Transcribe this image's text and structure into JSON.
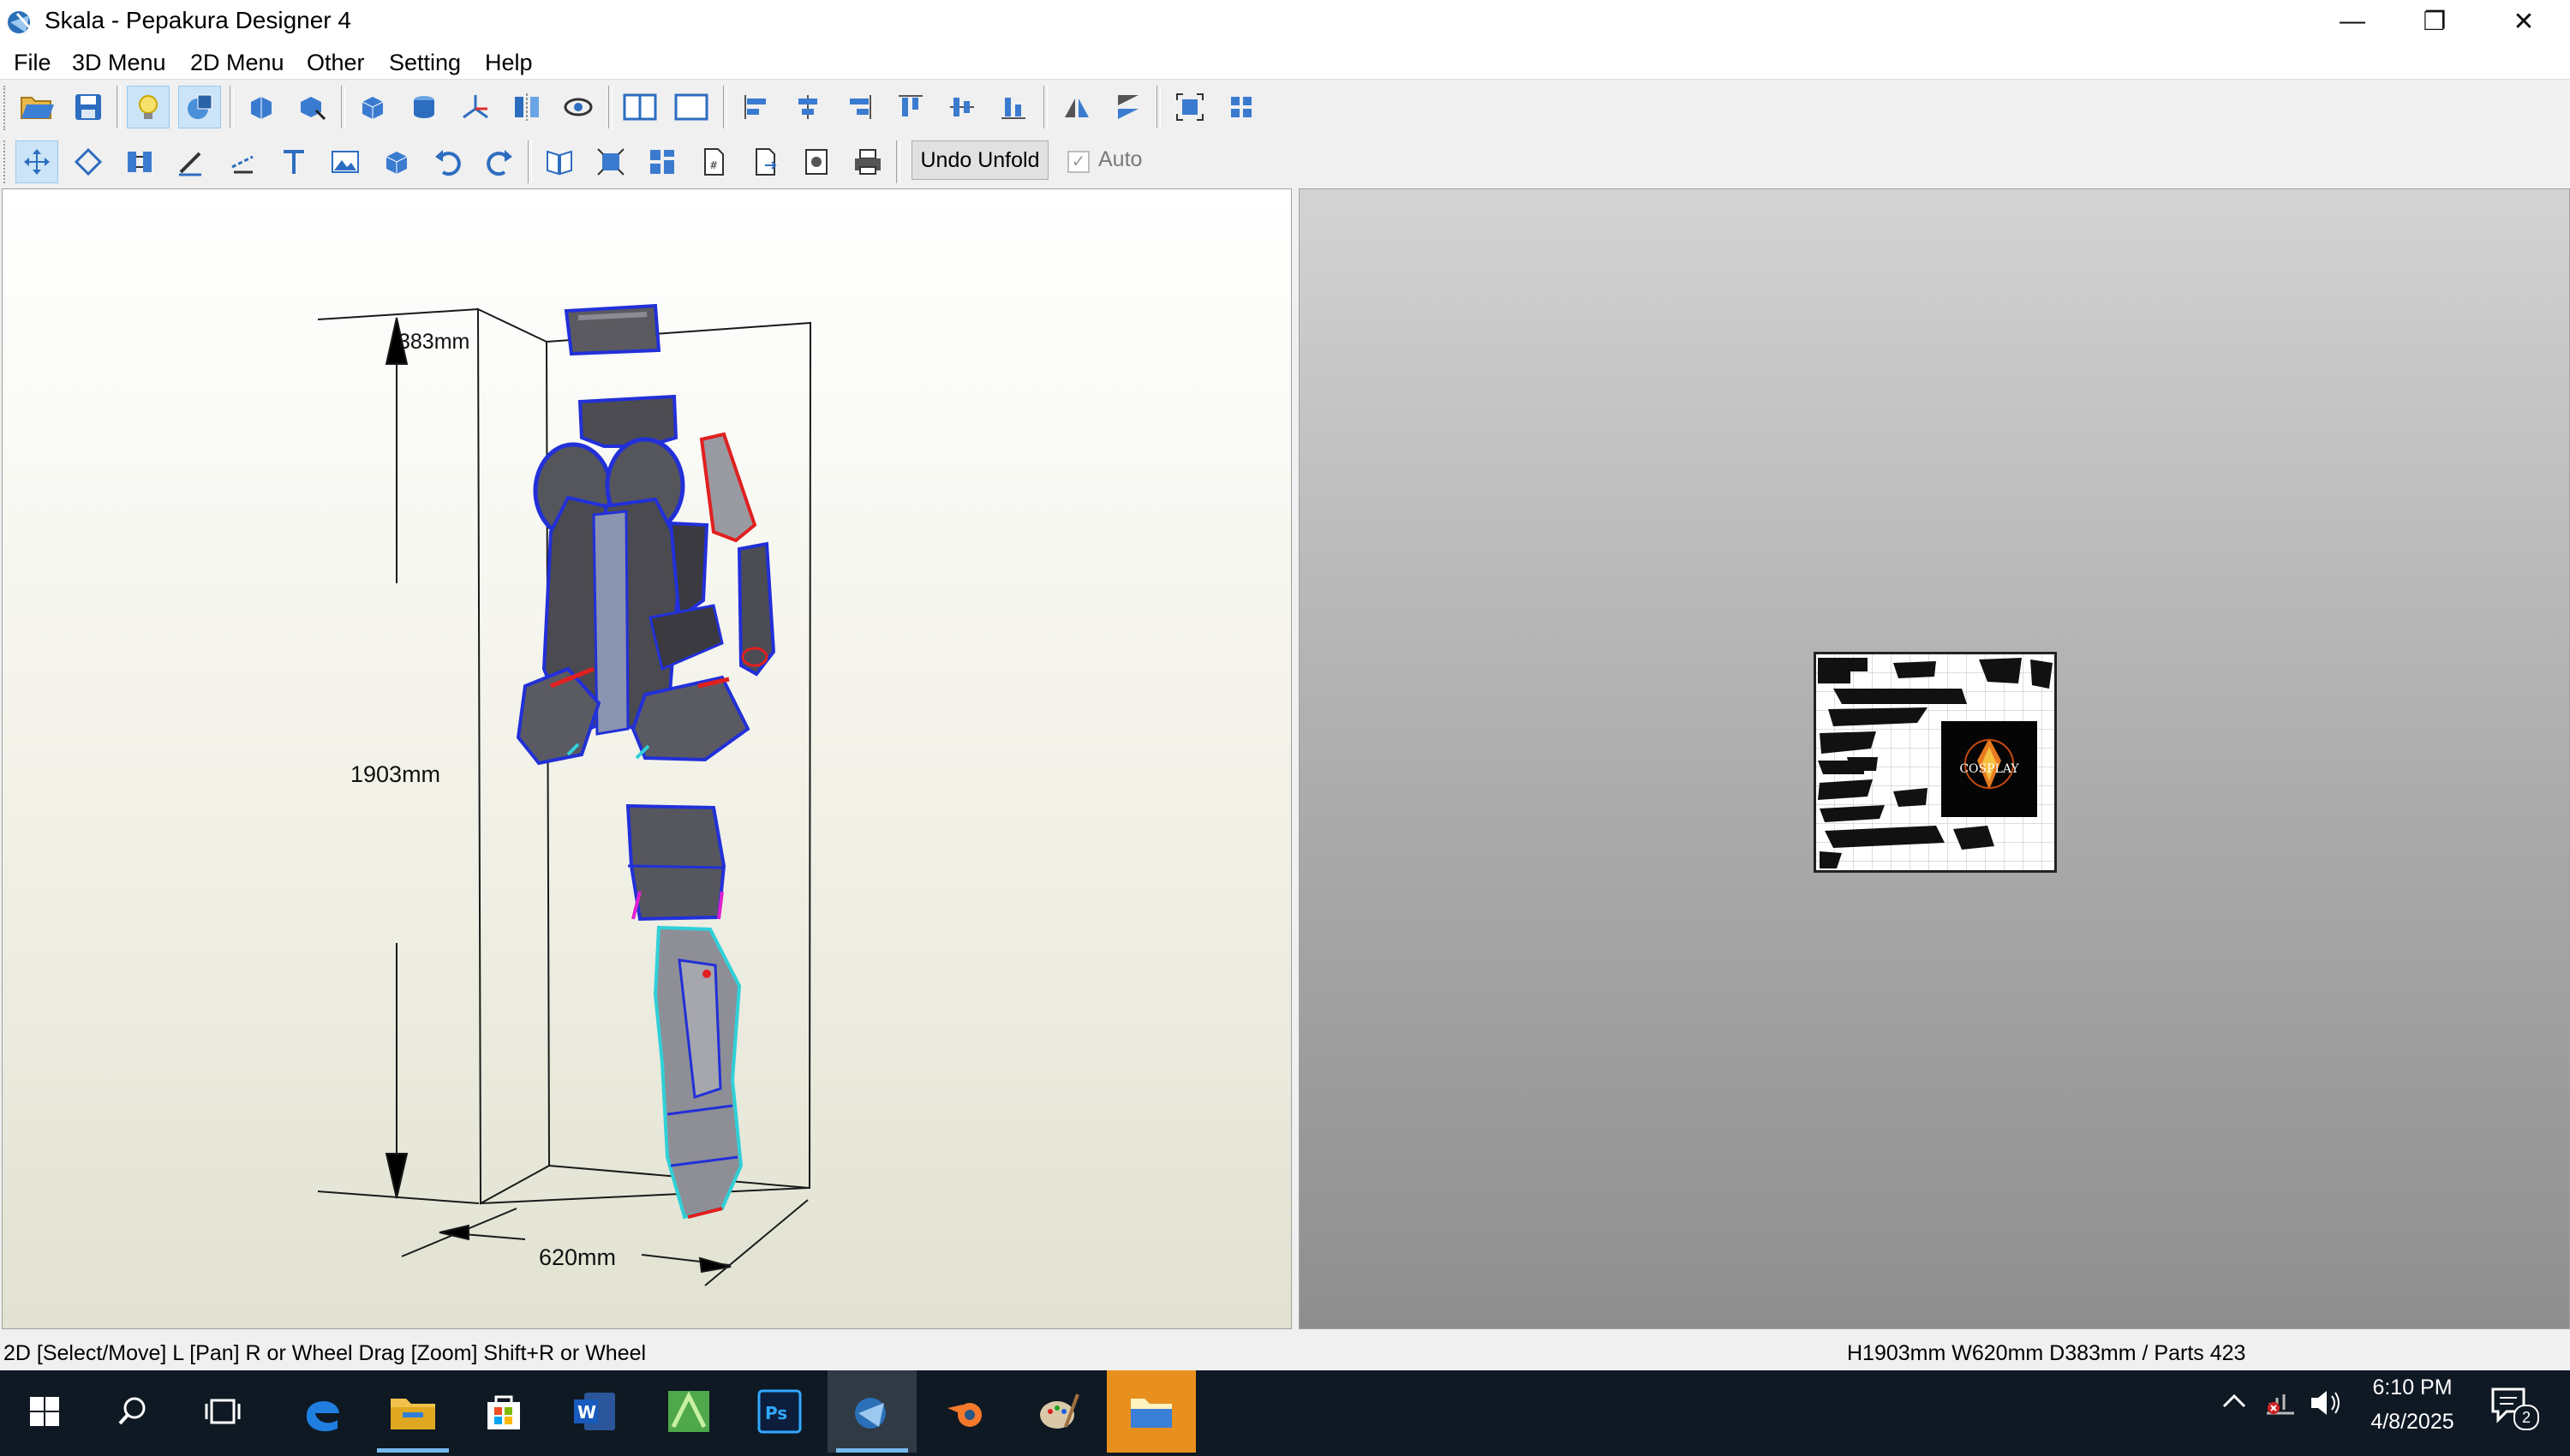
{
  "window": {
    "title": "Skala - Pepakura Designer 4",
    "minimize_glyph": "—",
    "restore_glyph": "❐",
    "close_glyph": "✕"
  },
  "menu": [
    "File",
    "3D Menu",
    "2D Menu",
    "Other",
    "Setting",
    "Help"
  ],
  "toolbar": {
    "undo_unfold_label": "Undo Unfold",
    "auto_label": "Auto",
    "auto_checked": true,
    "row1_icons": [
      "open-icon",
      "save-icon",
      "light-icon",
      "texture-icon",
      "rotate-part-icon",
      "move-part-icon",
      "cube-icon",
      "cylinder-icon",
      "axis-icon",
      "mirror-icon",
      "show-edges-icon",
      "split-view-icon",
      "single-view-icon",
      "align-left-icon",
      "align-center-icon",
      "align-right-icon",
      "align-top-icon",
      "align-middle-icon",
      "align-bottom-icon",
      "flip-h-icon",
      "flip-v-icon",
      "fit-icon",
      "arrange-icon"
    ],
    "row2_icons": [
      "select-move-icon",
      "edge-icon",
      "join-icon",
      "pen-icon",
      "fold-line-icon",
      "text-icon",
      "image-icon",
      "box-icon",
      "undo-icon",
      "redo-icon",
      "book-icon",
      "zoom-fit-icon",
      "grid-icon",
      "page-icon",
      "page-export-icon",
      "snapshot-icon",
      "print-icon"
    ]
  },
  "view3d": {
    "height_label": "1903mm",
    "width_label": "620mm",
    "depth_label": "383mm"
  },
  "view2d": {
    "logo_text": "COSPLAY"
  },
  "status": {
    "left": "2D [Select/Move] L [Pan] R or Wheel Drag [Zoom] Shift+R or Wheel",
    "right": "H1903mm W620mm D383mm / Parts 423"
  },
  "taskbar": {
    "apps": [
      "start-icon",
      "search-icon",
      "task-view-icon",
      "edge-browser-icon",
      "file-explorer-icon",
      "store-icon",
      "word-icon",
      "sketch-icon",
      "photoshop-icon",
      "pepakura-icon",
      "blender-icon",
      "paint-icon",
      "folder-icon"
    ],
    "time": "6:10 PM",
    "date": "4/8/2025",
    "notification_count": "2",
    "colors": {
      "background": "#0f1923",
      "active": "#2f3a44",
      "underline": "#76b9ed"
    }
  }
}
